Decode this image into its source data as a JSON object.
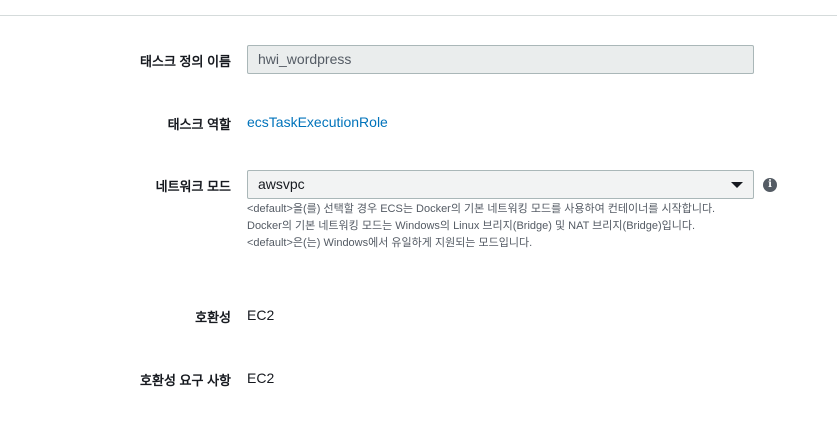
{
  "task_definition_name": {
    "label": "태스크 정의 이름",
    "value": "hwi_wordpress"
  },
  "task_role": {
    "label": "태스크 역할",
    "value": "ecsTaskExecutionRole"
  },
  "network_mode": {
    "label": "네트워크 모드",
    "selected": "awsvpc",
    "info_icon": "info-icon",
    "help_lines": [
      "<default>을(를) 선택할 경우 ECS는 Docker의 기본 네트워킹 모드를 사용하여 컨테이너를 시작합니다.",
      "Docker의 기본 네트워킹 모드는 Windows의 Linux 브리지(Bridge) 및 NAT 브리지(Bridge)입니다.",
      "<default>은(는) Windows에서 유일하게 지원되는 모드입니다."
    ]
  },
  "compatibility": {
    "label": "호환성",
    "value": "EC2"
  },
  "compatibility_requirements": {
    "label": "호환성 요구 사항",
    "value": "EC2"
  },
  "colors": {
    "link": "#0073bb",
    "input_bg": "#eaeded",
    "border": "#aab7b8"
  }
}
